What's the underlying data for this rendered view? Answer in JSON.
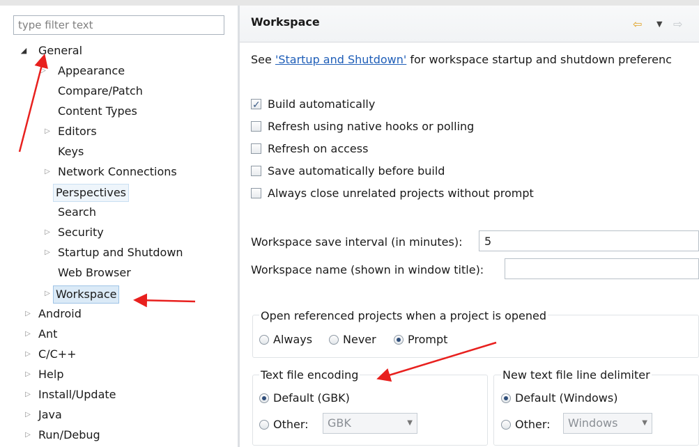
{
  "filter": {
    "placeholder": "type filter text"
  },
  "tree": {
    "items": [
      {
        "label": "General",
        "twisty": "open"
      },
      {
        "label": "Appearance",
        "twisty": "closed"
      },
      {
        "label": "Compare/Patch",
        "twisty": ""
      },
      {
        "label": "Content Types",
        "twisty": ""
      },
      {
        "label": "Editors",
        "twisty": "closed"
      },
      {
        "label": "Keys",
        "twisty": ""
      },
      {
        "label": "Network Connections",
        "twisty": "closed"
      },
      {
        "label": "Perspectives",
        "twisty": ""
      },
      {
        "label": "Search",
        "twisty": ""
      },
      {
        "label": "Security",
        "twisty": "closed"
      },
      {
        "label": "Startup and Shutdown",
        "twisty": "closed"
      },
      {
        "label": "Web Browser",
        "twisty": ""
      },
      {
        "label": "Workspace",
        "twisty": "closed"
      },
      {
        "label": "Android",
        "twisty": "closed"
      },
      {
        "label": "Ant",
        "twisty": "closed"
      },
      {
        "label": "C/C++",
        "twisty": "closed"
      },
      {
        "label": "Help",
        "twisty": "closed"
      },
      {
        "label": "Install/Update",
        "twisty": "closed"
      },
      {
        "label": "Java",
        "twisty": "closed"
      },
      {
        "label": "Run/Debug",
        "twisty": "closed"
      }
    ]
  },
  "page": {
    "title": "Workspace",
    "desc_prefix": "See ",
    "desc_link": "'Startup and Shutdown'",
    "desc_suffix": " for workspace startup and shutdown preferenc"
  },
  "options": {
    "build_auto": "Build automatically",
    "refresh_native": "Refresh using native hooks or polling",
    "refresh_access": "Refresh on access",
    "save_before_build": "Save automatically before build",
    "close_unrelated": "Always close unrelated projects without prompt"
  },
  "save_interval": {
    "label": "Workspace save interval (in minutes):",
    "value": "5"
  },
  "ws_name": {
    "label": "Workspace name (shown in window title):",
    "value": ""
  },
  "open_ref": {
    "label": "Open referenced projects when a project is opened",
    "always": "Always",
    "never": "Never",
    "prompt": "Prompt"
  },
  "encoding": {
    "label": "Text file encoding",
    "default": "Default (GBK)",
    "other": "Other:",
    "combo": "GBK"
  },
  "delimiter": {
    "label": "New text file line delimiter",
    "default": "Default (Windows)",
    "other": "Other:",
    "combo": "Windows"
  },
  "icons": {
    "back": "back-arrow-icon",
    "menu": "dropdown-icon",
    "forward": "forward-arrow-icon"
  },
  "colors": {
    "annotation": "#e8201e",
    "link": "#1f5eb8",
    "selection": "#dbeaf7"
  }
}
